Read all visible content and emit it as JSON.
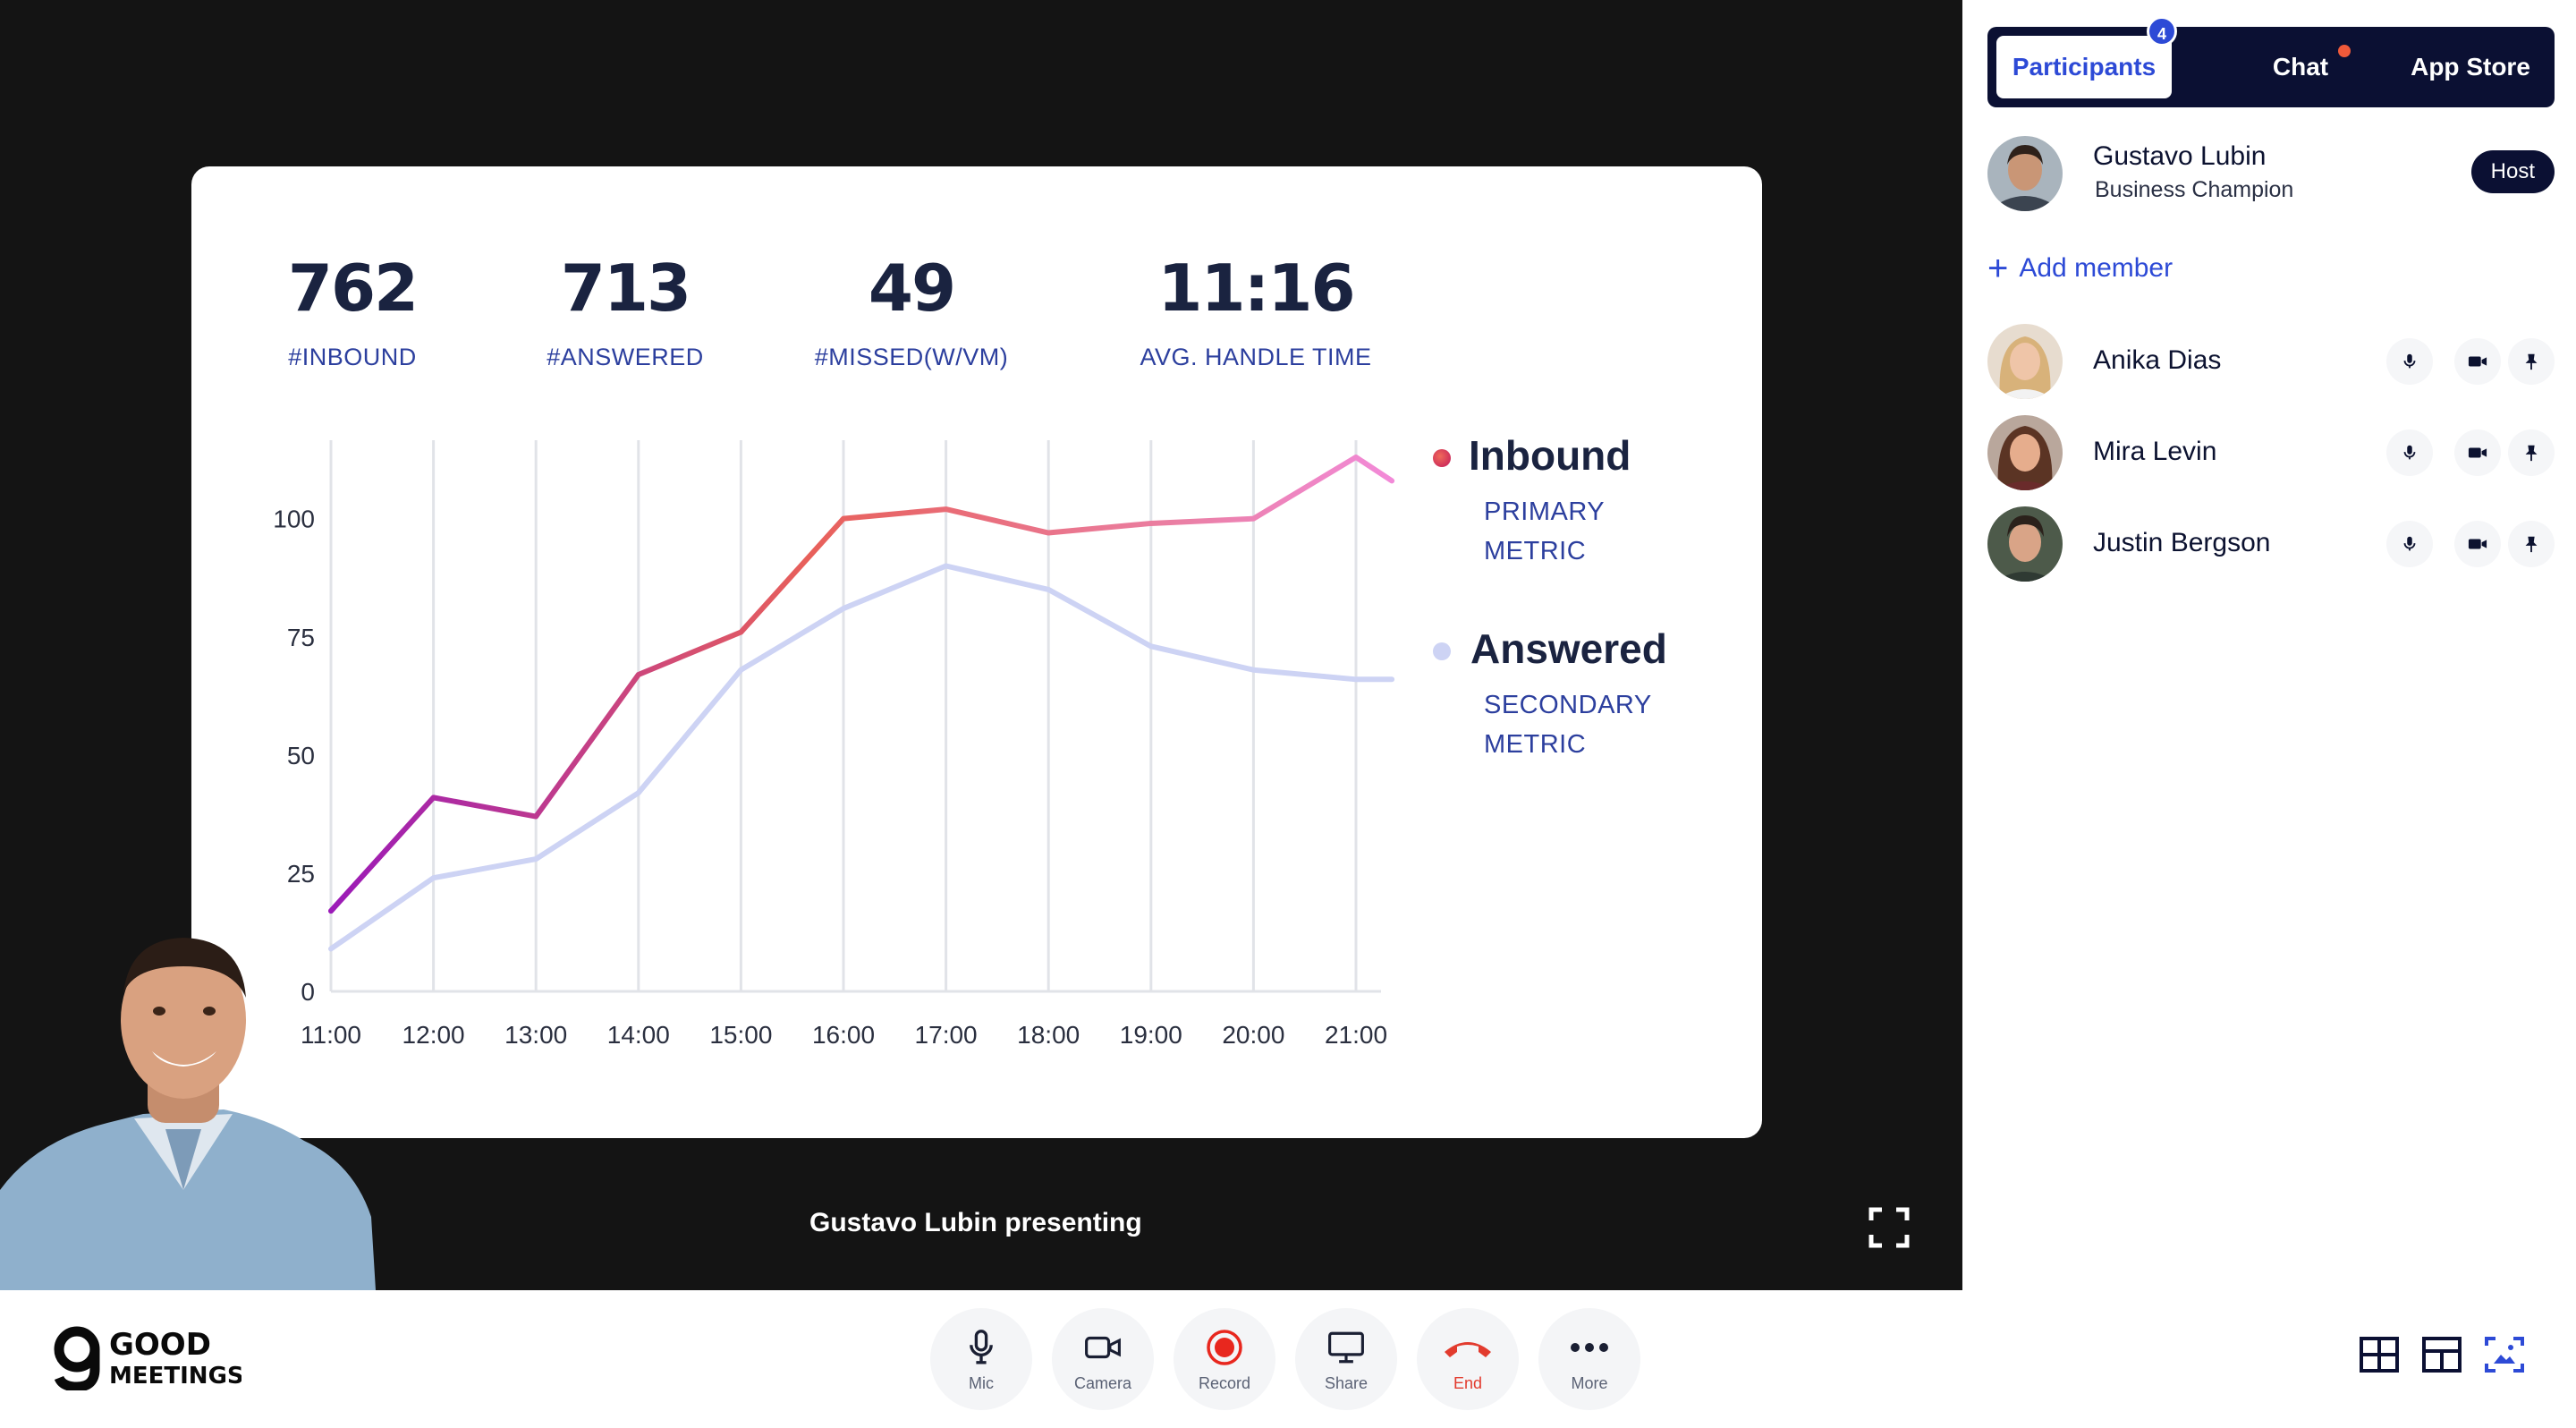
{
  "stage": {
    "presenting_label": "Gustavo Lubin presenting"
  },
  "slide": {
    "kpis": [
      {
        "value": "762",
        "label": "#INBOUND"
      },
      {
        "value": "713",
        "label": "#ANSWERED"
      },
      {
        "value": "49",
        "label": "#MISSED(W/VM)"
      },
      {
        "value": "11:16",
        "label": "AVG. HANDLE TIME"
      }
    ],
    "legend": [
      {
        "name": "Inbound",
        "sub1": "PRIMARY",
        "sub2": "METRIC"
      },
      {
        "name": "Answered",
        "sub1": "SECONDARY",
        "sub2": "METRIC"
      }
    ]
  },
  "chart_data": {
    "type": "line",
    "x": [
      "11:00",
      "12:00",
      "13:00",
      "14:00",
      "15:00",
      "16:00",
      "17:00",
      "18:00",
      "19:00",
      "20:00",
      "21:00"
    ],
    "series": [
      {
        "name": "Inbound",
        "values": [
          17,
          41,
          37,
          67,
          76,
          100,
          102,
          97,
          99,
          100,
          113,
          108
        ],
        "x_extra_end": true,
        "color_start": "#9b1ab8",
        "color_mid": "#e8605a",
        "color_end": "#f28ad8"
      },
      {
        "name": "Answered",
        "values": [
          9,
          24,
          28,
          42,
          68,
          81,
          90,
          85,
          73,
          68,
          66,
          66
        ],
        "x_extra_end": true,
        "color": "#cdd3f4"
      }
    ],
    "yticks": [
      0,
      25,
      50,
      75,
      100
    ],
    "ylim": [
      0,
      120
    ],
    "grid": "vertical"
  },
  "sidebar": {
    "tabs": [
      {
        "label": "Participants",
        "badge": "4",
        "active": true
      },
      {
        "label": "Chat",
        "has_dot": true
      },
      {
        "label": "App Store"
      }
    ],
    "host": {
      "name": "Gustavo Lubin",
      "role": "Business Champion",
      "tag": "Host"
    },
    "add_member": "Add member",
    "members": [
      {
        "name": "Anika Dias"
      },
      {
        "name": "Mira Levin"
      },
      {
        "name": "Justin Bergson"
      }
    ]
  },
  "controls": [
    {
      "label": "Mic",
      "icon": "mic-icon"
    },
    {
      "label": "Camera",
      "icon": "camera-icon"
    },
    {
      "label": "Record",
      "icon": "record-icon"
    },
    {
      "label": "Share",
      "icon": "share-screen-icon"
    },
    {
      "label": "End",
      "icon": "end-call-icon"
    },
    {
      "label": "More",
      "icon": "more-icon"
    }
  ],
  "brand": {
    "line1": "GOOD",
    "line2": "MEETINGS"
  },
  "colors": {
    "accent": "#2d4ad6",
    "dark": "#0b1033",
    "end": "#e23b2e",
    "record": "#e8271e"
  }
}
